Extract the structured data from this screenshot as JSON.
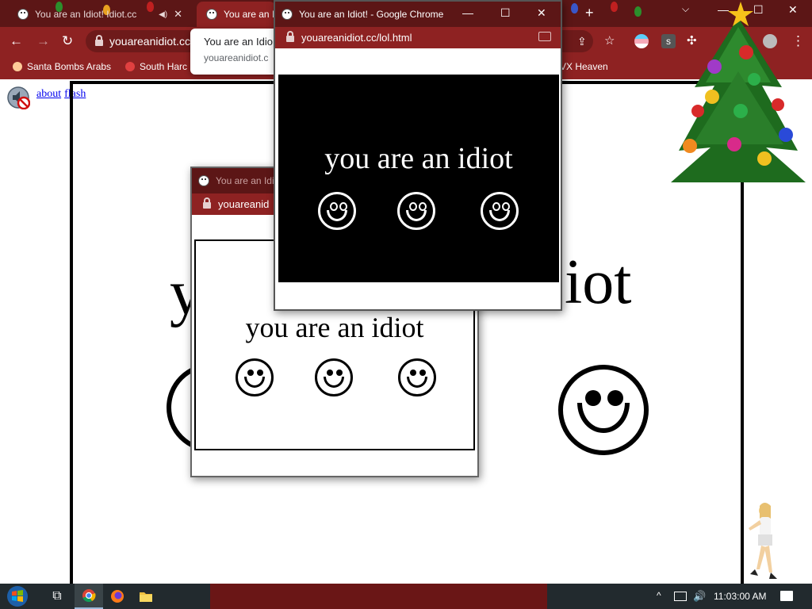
{
  "browser": {
    "tabs": [
      {
        "title": "You are an Idiot! Idiot.cc"
      },
      {
        "title": "You are an I"
      }
    ],
    "window_controls": {
      "minimize": "—",
      "maximize": "☐",
      "close": "✕"
    },
    "new_tab": "+",
    "address": "youareanidiot.cc",
    "nav": {
      "back": "←",
      "forward": "→",
      "reload": "↻"
    },
    "bookmarks": [
      "Santa Bombs Arabs",
      "South Harc",
      "VX Heaven"
    ],
    "ext_letter": "s",
    "menu": "⋮"
  },
  "hover_card": {
    "title": "You are an Idio",
    "url": "youareanidiot.c"
  },
  "page": {
    "links": [
      "about",
      "flash"
    ],
    "big_text_left": "y",
    "big_text_right": "iot"
  },
  "popup_front": {
    "title": "You are an Idiot! - Google Chrome",
    "url": "youareanidiot.cc/lol.html",
    "message": "you are an idiot",
    "minimize": "—",
    "maximize": "☐",
    "close": "✕"
  },
  "popup_back": {
    "title": "You are an Idio",
    "url": "youareanid",
    "message": "you are an idiot"
  },
  "taskbar": {
    "time": "11:03:00 AM",
    "tray_up": "^",
    "tray_speaker": "🔊"
  },
  "colors": {
    "chrome_dark": "#5c1616",
    "chrome_main": "#8e2222",
    "link": "#0000ee",
    "taskbar": "#222a2e"
  }
}
